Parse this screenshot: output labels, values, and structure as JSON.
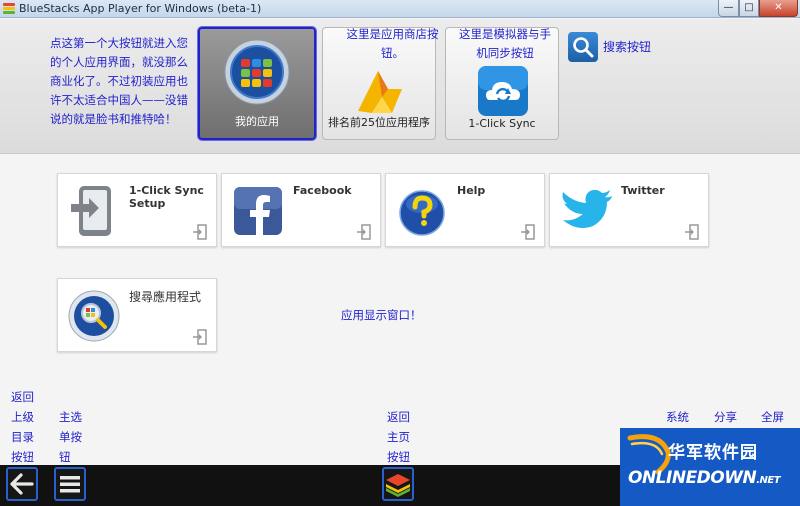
{
  "window": {
    "title": "BlueStacks App Player for Windows (beta-1)",
    "min_glyph": "—",
    "max_glyph": "□",
    "close_glyph": "✕"
  },
  "header": {
    "annotation_left": "点这第一个大按钮就进入您的个人应用界面，就没那么商业化了。不过初装应用也许不太适合中国人——没错说的就是脸书和推特哈！",
    "annotation_store": "这里是应用商店按钮。",
    "annotation_sync": "这里是模拟器与手机同步按钮",
    "my_apps_label": "我的应用",
    "store_label": "排名前25位应用程序",
    "sync_label": "1-Click Sync",
    "search_label": "搜索按钮"
  },
  "apps": [
    {
      "label": "1-Click Sync Setup",
      "icon": "phone-sync-icon"
    },
    {
      "label": "Facebook",
      "icon": "facebook-icon"
    },
    {
      "label": "Help",
      "icon": "help-icon"
    },
    {
      "label": "Twitter",
      "icon": "twitter-icon"
    },
    {
      "label": "搜尋應用程式",
      "icon": "search-apps-icon"
    }
  ],
  "center_note": "应用显示窗口！",
  "nav_notes": {
    "back_col": [
      "返回",
      "上级",
      "目录",
      "按钮"
    ],
    "menu_col": [
      "主选",
      "单按",
      "钮"
    ],
    "home_col": [
      "返回",
      "主页",
      "按钮"
    ],
    "system": "系统",
    "share": "分享",
    "fullscreen": "全屏"
  },
  "watermark": {
    "cn": "华军软件园",
    "en": "ONLINEDOWN",
    "suffix": ".NET"
  },
  "colors": {
    "annotation": "#2222cc",
    "accent_blue": "#1559c4"
  }
}
